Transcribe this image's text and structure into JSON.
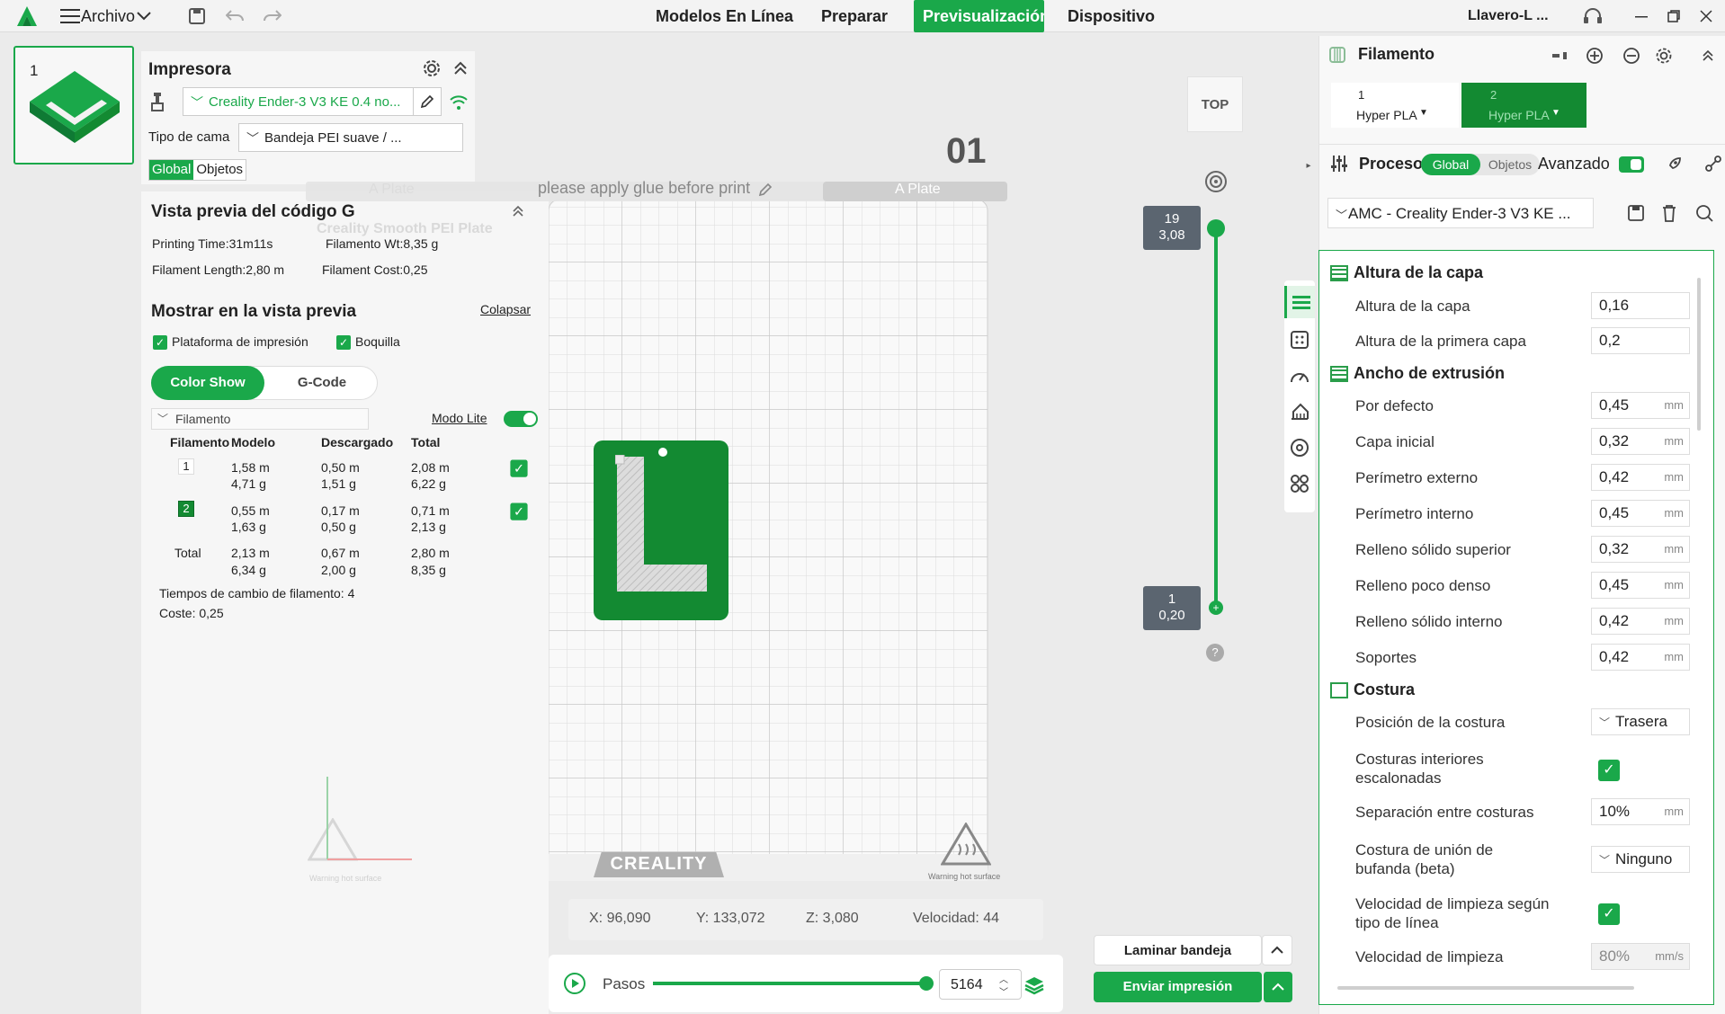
{
  "topbar": {
    "menu_label": "Archivo",
    "tabs": [
      "Modelos En Línea",
      "Preparar",
      "Previsualización",
      "Dispositivo"
    ],
    "active_tab": "Previsualización",
    "project_name": "Llavero-L ..."
  },
  "plate_thumb": {
    "index": "1"
  },
  "printer": {
    "title": "Impresora",
    "name": "Creality Ender-3 V3 KE 0.4 no...",
    "bed_label": "Tipo de cama",
    "bed_value": "Bandeja PEI suave / ...",
    "tab_global": "Global",
    "tab_objects": "Objetos"
  },
  "gcode_preview": {
    "title": "Vista previa del código G",
    "printing_time": "Printing Time:31m11s",
    "filament_wt": "Filamento Wt:8,35 g",
    "filament_length": "Filament Length:2,80 m",
    "filament_cost": "Filament Cost:0,25"
  },
  "show_preview": {
    "title": "Mostrar en la vista previa",
    "collapse": "Colapsar",
    "opt_platform": "Plataforma de impresión",
    "opt_nozzle": "Boquilla",
    "btn_color_show": "Color Show",
    "btn_gcode": "G-Code",
    "dropdown": "Filamento",
    "lite_mode": "Modo Lite"
  },
  "filament_table": {
    "headers": [
      "Filamento",
      "Modelo",
      "Descargado",
      "Total"
    ],
    "rows": [
      {
        "id": "1",
        "model_m": "1,58 m",
        "model_g": "4,71 g",
        "dl_m": "0,50 m",
        "dl_g": "1,51 g",
        "tot_m": "2,08 m",
        "tot_g": "6,22 g"
      },
      {
        "id": "2",
        "model_m": "0,55 m",
        "model_g": "1,63 g",
        "dl_m": "0,17 m",
        "dl_g": "0,50 g",
        "tot_m": "0,71 m",
        "tot_g": "2,13 g"
      }
    ],
    "total": {
      "label": "Total",
      "model_m": "2,13 m",
      "model_g": "6,34 g",
      "dl_m": "0,67 m",
      "dl_g": "2,00 g",
      "tot_m": "2,80 m",
      "tot_g": "8,35 g"
    },
    "change_times": "Tiempos de cambio de filamento:  4",
    "cost": "Coste:  0,25"
  },
  "viewport": {
    "plate_number": "01",
    "plate_label_left": "A Plate",
    "plate_label_right": "A Plate",
    "glue_notice": "please apply glue before print",
    "bed_name": "Creality Smooth PEI Plate",
    "brand": "CREALITY",
    "warning_left": "Warning hot surface",
    "warning_right": "Warning hot surface",
    "view_top": "TOP",
    "coords": {
      "x": "X: 96,090",
      "y": "Y: 133,072",
      "z": "Z: 3,080",
      "speed": "Velocidad: 44"
    },
    "layer_top": {
      "layer": "19",
      "height": "3,08"
    },
    "layer_bottom": {
      "layer": "1",
      "height": "0,20"
    },
    "help": "?"
  },
  "steps": {
    "label": "Pasos",
    "value": "5164",
    "progress": 1.0
  },
  "actions": {
    "slice": "Laminar bandeja",
    "send": "Enviar impresión"
  },
  "filament_panel": {
    "title": "Filamento",
    "slots": [
      {
        "num": "1",
        "name": "Hyper PLA"
      },
      {
        "num": "2",
        "name": "Hyper PLA"
      }
    ]
  },
  "process": {
    "title": "Proceso",
    "tab_global": "Global",
    "tab_objects": "Objetos",
    "advanced": "Avanzado",
    "profile": "AMC - Creality Ender-3 V3 KE ..."
  },
  "params": {
    "sec_layer": "Altura de la capa",
    "layer_height": {
      "label": "Altura de la capa",
      "value": "0,16"
    },
    "first_layer": {
      "label": "Altura de la primera capa",
      "value": "0,2"
    },
    "sec_width": "Ancho de extrusión",
    "widths": [
      {
        "label": "Por defecto",
        "value": "0,45",
        "unit": "mm"
      },
      {
        "label": "Capa inicial",
        "value": "0,32",
        "unit": "mm"
      },
      {
        "label": "Perímetro externo",
        "value": "0,42",
        "unit": "mm"
      },
      {
        "label": "Perímetro interno",
        "value": "0,45",
        "unit": "mm"
      },
      {
        "label": "Relleno sólido superior",
        "value": "0,32",
        "unit": "mm"
      },
      {
        "label": "Relleno poco denso",
        "value": "0,45",
        "unit": "mm"
      },
      {
        "label": "Relleno sólido interno",
        "value": "0,42",
        "unit": "mm"
      },
      {
        "label": "Soportes",
        "value": "0,42",
        "unit": "mm"
      }
    ],
    "sec_seam": "Costura",
    "seam_pos": {
      "label": "Posición de la costura",
      "value": "Trasera"
    },
    "seam_staggered": {
      "label": "Costuras interiores escalonadas"
    },
    "seam_gap": {
      "label": "Separación entre costuras",
      "value": "10%",
      "unit": "mm"
    },
    "scarf": {
      "label": "Costura de unión de bufanda (beta)",
      "value": "Ninguno"
    },
    "wipe_speed_type": {
      "label": "Velocidad de limpieza según tipo de línea"
    },
    "wipe_speed": {
      "label": "Velocidad de limpieza",
      "value": "80%",
      "unit": "mm/s"
    }
  },
  "colors": {
    "accent": "#1aa84a",
    "model_green": "#138a32"
  }
}
